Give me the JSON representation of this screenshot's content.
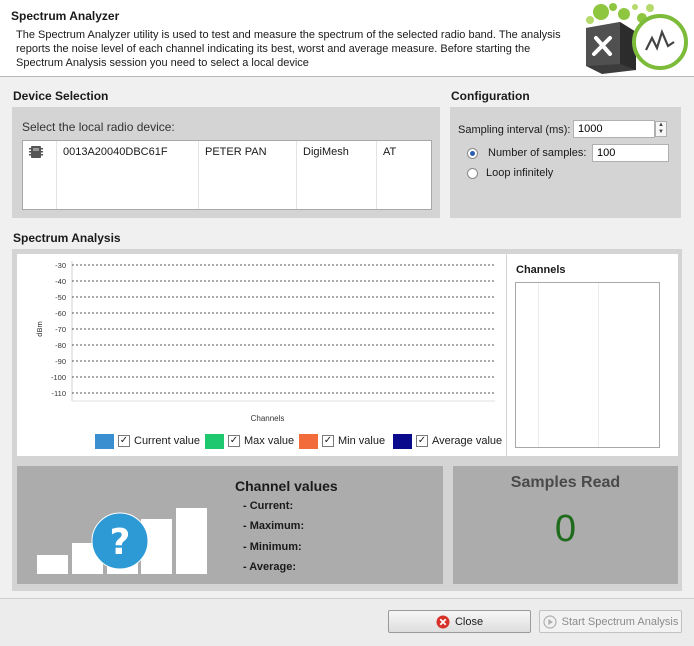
{
  "header": {
    "title": "Spectrum Analyzer",
    "description": "The Spectrum Analyzer utility is used to test and measure the spectrum of the selected radio band. The analysis reports the noise level of each channel indicating its best, worst and average measure. Before starting the Spectrum Analysis session you need to select a local device"
  },
  "device_selection": {
    "title": "Device Selection",
    "prompt": "Select the local radio device:",
    "devices": [
      {
        "icon": "radio-module-icon",
        "address": "0013A20040DBC61F",
        "name": "PETER PAN",
        "protocol": "DigiMesh",
        "mode": "AT"
      }
    ]
  },
  "configuration": {
    "title": "Configuration",
    "sampling_label": "Sampling interval (ms):",
    "sampling_value": "1000",
    "samples_label": "Number of samples:",
    "samples_value": "100",
    "samples_selected": true,
    "loop_label": "Loop infinitely",
    "loop_selected": false
  },
  "spectrum": {
    "title": "Spectrum Analysis",
    "channels_title": "Channels",
    "legend": [
      {
        "label": "Current value",
        "color": "#3a8fd0",
        "checked": true
      },
      {
        "label": "Max value",
        "color": "#1ec86e",
        "checked": true
      },
      {
        "label": "Min value",
        "color": "#f26b3a",
        "checked": true
      },
      {
        "label": "Average value",
        "color": "#0a0a8c",
        "checked": true
      }
    ],
    "chart_data": {
      "type": "bar",
      "xlabel": "Channels",
      "ylabel": "dBm",
      "ylim": [
        -110,
        -30
      ],
      "yticks": [
        "-30",
        "-40",
        "-50",
        "-60",
        "-70",
        "-80",
        "-90",
        "-100",
        "-110"
      ],
      "grid": true,
      "categories": [],
      "series": []
    }
  },
  "channel_values": {
    "title": "Channel values",
    "current_label": "- Current:",
    "maximum_label": "- Maximum:",
    "minimum_label": "- Minimum:",
    "average_label": "- Average:"
  },
  "samples_read": {
    "title": "Samples Read",
    "value": "0",
    "value_color": "#1e6b1e"
  },
  "footer": {
    "close_label": "Close",
    "start_label": "Start Spectrum Analysis",
    "start_enabled": false
  }
}
